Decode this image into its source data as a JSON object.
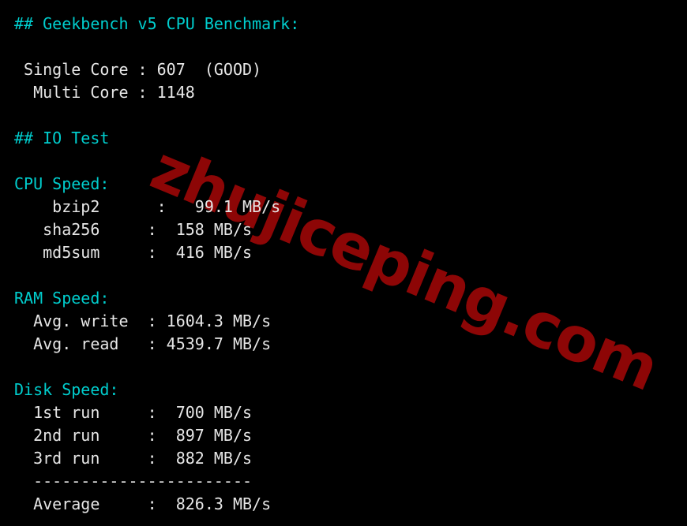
{
  "terminal": {
    "background_color": "#000000",
    "text_color": "#e6e6e6",
    "heading_color": "#00cdcd",
    "watermark": {
      "text": "zhujiceping.com",
      "color": "#8d0606"
    }
  },
  "lines": {
    "l01": "## Geekbench v5 CPU Benchmark:",
    "l02": " ",
    "l03": " Single Core : 607  (GOOD)",
    "l04": "  Multi Core : 1148",
    "l05": " ",
    "l06": "## IO Test",
    "l07": " ",
    "l08": "CPU Speed:",
    "l09": "    bzip2      :   99.1 MB/s",
    "l10": "   sha256     :  158 MB/s",
    "l11": "   md5sum     :  416 MB/s",
    "l12": " ",
    "l13": "RAM Speed:",
    "l14": "  Avg. write  : 1604.3 MB/s",
    "l15": "  Avg. read   : 4539.7 MB/s",
    "l16": " ",
    "l17": "Disk Speed:",
    "l18": "  1st run     :  700 MB/s",
    "l19": "  2nd run     :  897 MB/s",
    "l20": "  3rd run     :  882 MB/s",
    "l21": "  -----------------------",
    "l22": "  Average     :  826.3 MB/s"
  },
  "report": {
    "geekbench": {
      "heading": "## Geekbench v5 CPU Benchmark:",
      "single_core_label": "Single Core",
      "single_core_value": "607",
      "single_core_rating": "(GOOD)",
      "multi_core_label": "Multi Core",
      "multi_core_value": "1148"
    },
    "io_test": {
      "heading": "## IO Test",
      "cpu_speed": {
        "label": "CPU Speed:",
        "rows": [
          {
            "name": "bzip2",
            "value": "99.1 MB/s"
          },
          {
            "name": "sha256",
            "value": "158 MB/s"
          },
          {
            "name": "md5sum",
            "value": "416 MB/s"
          }
        ]
      },
      "ram_speed": {
        "label": "RAM Speed:",
        "rows": [
          {
            "name": "Avg. write",
            "value": "1604.3 MB/s"
          },
          {
            "name": "Avg. read",
            "value": "4539.7 MB/s"
          }
        ]
      },
      "disk_speed": {
        "label": "Disk Speed:",
        "rows": [
          {
            "name": "1st run",
            "value": "700 MB/s"
          },
          {
            "name": "2nd run",
            "value": "897 MB/s"
          },
          {
            "name": "3rd run",
            "value": "882 MB/s"
          }
        ],
        "separator": "-----------------------",
        "average_label": "Average",
        "average_value": "826.3 MB/s"
      }
    }
  }
}
